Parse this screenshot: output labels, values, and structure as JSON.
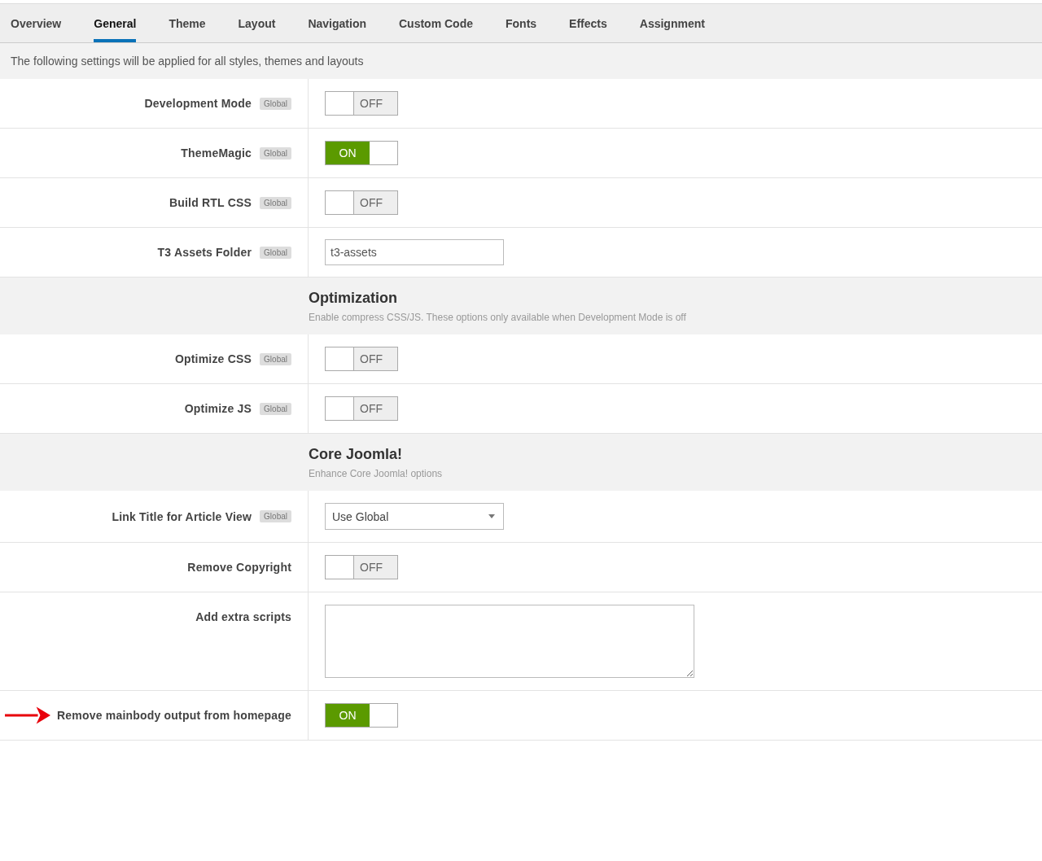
{
  "tabs": [
    {
      "label": "Overview",
      "selected": false
    },
    {
      "label": "General",
      "selected": true
    },
    {
      "label": "Theme",
      "selected": false
    },
    {
      "label": "Layout",
      "selected": false
    },
    {
      "label": "Navigation",
      "selected": false
    },
    {
      "label": "Custom Code",
      "selected": false
    },
    {
      "label": "Fonts",
      "selected": false
    },
    {
      "label": "Effects",
      "selected": false
    },
    {
      "label": "Assignment",
      "selected": false
    }
  ],
  "description": "The following settings will be applied for all styles, themes and layouts",
  "rows": [
    {
      "kind": "toggle",
      "label": "Development Mode",
      "badge": "Global",
      "on": false,
      "state_label": "OFF"
    },
    {
      "kind": "toggle",
      "label": "ThemeMagic",
      "badge": "Global",
      "on": true,
      "state_label": "ON"
    },
    {
      "kind": "toggle",
      "label": "Build RTL CSS",
      "badge": "Global",
      "on": false,
      "state_label": "OFF"
    },
    {
      "kind": "text",
      "label": "T3 Assets Folder",
      "badge": "Global",
      "value": "t3-assets"
    },
    {
      "kind": "section",
      "title": "Optimization",
      "subtitle": "Enable compress CSS/JS. These options only available when Development Mode is off"
    },
    {
      "kind": "toggle",
      "label": "Optimize CSS",
      "badge": "Global",
      "on": false,
      "state_label": "OFF"
    },
    {
      "kind": "toggle",
      "label": "Optimize JS",
      "badge": "Global",
      "on": false,
      "state_label": "OFF"
    },
    {
      "kind": "section",
      "title": "Core Joomla!",
      "subtitle": "Enhance Core Joomla! options"
    },
    {
      "kind": "select",
      "label": "Link Title for Article View",
      "badge": "Global",
      "value": "Use Global"
    },
    {
      "kind": "toggle",
      "label": "Remove Copyright",
      "on": false,
      "state_label": "OFF"
    },
    {
      "kind": "textarea",
      "label": "Add extra scripts"
    },
    {
      "kind": "toggle",
      "label": "Remove mainbody output from homepage",
      "on": true,
      "state_label": "ON",
      "arrow": true
    }
  ]
}
